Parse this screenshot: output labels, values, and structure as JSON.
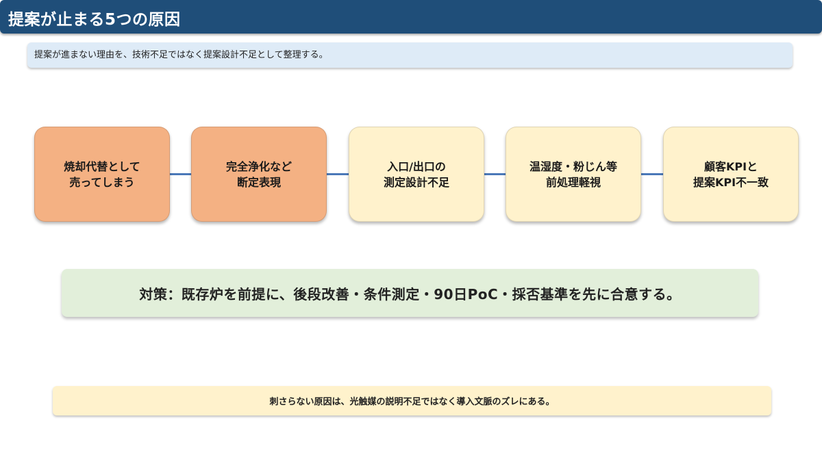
{
  "header": {
    "title": "提案が止まる5つの原因"
  },
  "subtitle": {
    "text": "提案が進まない理由を、技術不足ではなく提案設計不足として整理する。"
  },
  "causes": [
    {
      "label": "焼却代替として\n売ってしまう",
      "color": "#f4b183"
    },
    {
      "label": "完全浄化など\n断定表現",
      "color": "#f4b183"
    },
    {
      "label": "入口/出口の\n測定設計不足",
      "color": "#fff2cc"
    },
    {
      "label": "温湿度・粉じん等\n前処理軽視",
      "color": "#fff2cc"
    },
    {
      "label": "顧客KPIと\n提案KPI不一致",
      "color": "#fff2cc"
    }
  ],
  "solution": {
    "text": "対策：既存炉を前提に、後段改善・条件測定・90日PoC・採否基準を先に合意する。"
  },
  "note": {
    "text": "刺さらない原因は、光触媒の説明不足ではなく導入文脈のズレにある。"
  },
  "colors": {
    "header": "#1f4e79",
    "connector": "#4a78b8"
  }
}
